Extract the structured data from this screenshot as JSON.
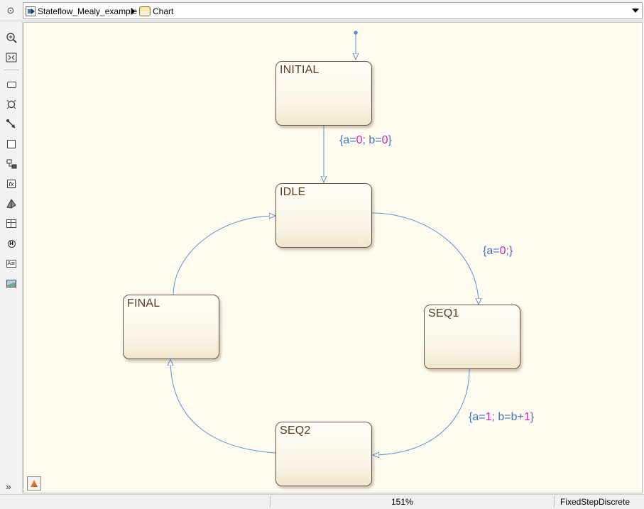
{
  "breadcrumb": {
    "model": "Stateflow_Mealy_example",
    "chart": "Chart"
  },
  "palette": {
    "tools": [
      "back-icon",
      "zoom-in-icon",
      "fit-view-icon",
      "state-icon",
      "junction-icon",
      "transition-icon",
      "box-icon",
      "default-transition-icon",
      "function-icon",
      "simulink-function-icon",
      "truth-table-icon",
      "history-junction-icon",
      "annotation-icon",
      "image-icon"
    ],
    "history_letter": "H",
    "annotation_letters": "A≡",
    "function_letters": "fx"
  },
  "chart": {
    "states": [
      {
        "id": "initial",
        "label": "INITIAL"
      },
      {
        "id": "idle",
        "label": "IDLE"
      },
      {
        "id": "seq1",
        "label": "SEQ1"
      },
      {
        "id": "seq2",
        "label": "SEQ2"
      },
      {
        "id": "final",
        "label": "FINAL"
      }
    ],
    "actions": {
      "initial_to_idle": [
        "{a=",
        "0",
        "; b=",
        "0",
        "}"
      ],
      "idle_to_seq1": [
        "{a=",
        "0",
        ";}"
      ],
      "seq1_to_seq2": [
        "{a=",
        "1",
        "; b=b+",
        "1",
        "}"
      ]
    },
    "colors": {
      "state_border": "#6b5340",
      "state_label": "#5a3a22",
      "transition": "#5b8fce",
      "action_text": "#3f73c8",
      "action_number": "#d222b6",
      "canvas_bg": "#fffcef"
    }
  },
  "status": {
    "zoom": "151%",
    "solver": "FixedStepDiscrete"
  }
}
